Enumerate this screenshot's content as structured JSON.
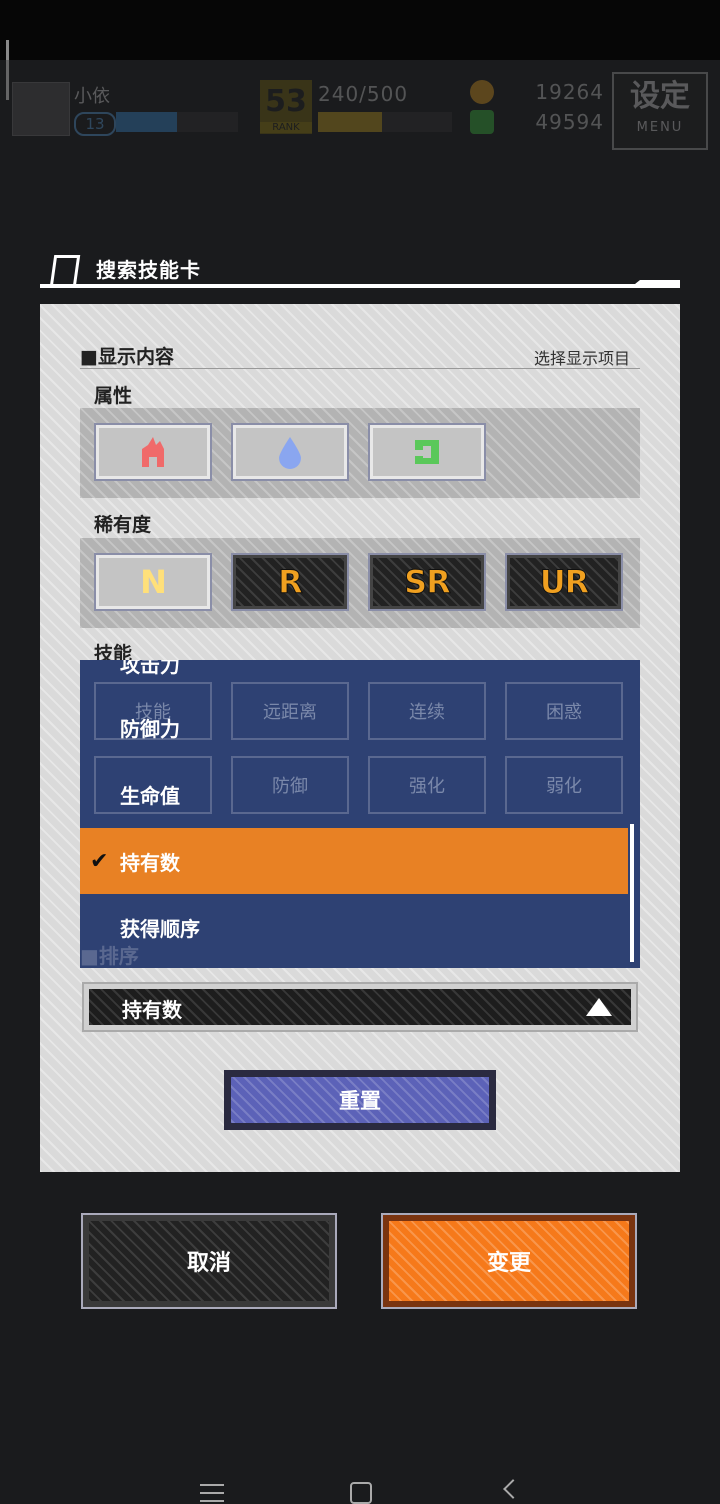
{
  "header": {
    "player_name": "小依",
    "level": "13",
    "exp_fraction": 0.5,
    "rank_value": "53",
    "rank_label": "RANK",
    "stamina": "240/500",
    "stamina_fraction": 0.48,
    "coins": "19264",
    "gems": "49594",
    "menu_title": "设定",
    "menu_label": "MENU"
  },
  "dialog": {
    "title": "搜索技能卡",
    "display_section": "■显示内容",
    "display_subtitle": "选择显示项目",
    "attribute_label": "属性",
    "rarity_label": "稀有度",
    "rarity_options": [
      {
        "label": "N",
        "selected": false
      },
      {
        "label": "R",
        "selected": true
      },
      {
        "label": "SR",
        "selected": true
      },
      {
        "label": "UR",
        "selected": true
      }
    ],
    "skill_label": "技能",
    "skill_grid_hidden": [
      "技能",
      "远距离",
      "连续",
      "困惑",
      "",
      "防御",
      "强化",
      "弱化"
    ],
    "sort_section": "■排序",
    "dropdown_items": [
      {
        "label": "攻击力",
        "selected": false
      },
      {
        "label": "防御力",
        "selected": false
      },
      {
        "label": "生命值",
        "selected": false
      },
      {
        "label": "持有数",
        "selected": true
      },
      {
        "label": "获得顺序",
        "selected": false
      }
    ],
    "sort_value": "持有数",
    "reset_label": "重置"
  },
  "footer": {
    "cancel_label": "取消",
    "change_label": "变更"
  },
  "colors": {
    "accent_orange": "#e88124",
    "dropdown_blue": "#2e4173",
    "reset_purple": "#5c62b8"
  }
}
